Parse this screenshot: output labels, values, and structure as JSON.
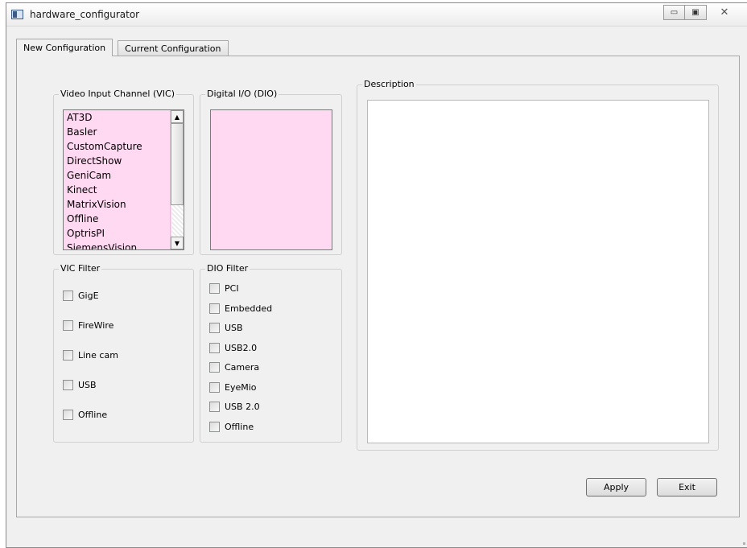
{
  "window": {
    "title": "hardware_configurator",
    "minimize": "▭",
    "maximize": "▣",
    "close": "✕"
  },
  "tabs": [
    {
      "label": "New Configuration",
      "active": true
    },
    {
      "label": "Current Configuration",
      "active": false
    }
  ],
  "vic": {
    "title": "Video Input Channel (VIC)",
    "items": [
      "AT3D",
      "Basler",
      "CustomCapture",
      "DirectShow",
      "GeniCam",
      "Kinect",
      "MatrixVision",
      "Offline",
      "OptrisPI",
      "SiemensVision"
    ],
    "list_color": "#ffd9f2"
  },
  "dio": {
    "title": "Digital I/O (DIO)",
    "items": []
  },
  "vic_filter": {
    "title": "VIC Filter",
    "options": [
      {
        "label": "GigE",
        "checked": false
      },
      {
        "label": "FireWire",
        "checked": false
      },
      {
        "label": "Line cam",
        "checked": false
      },
      {
        "label": "USB",
        "checked": false
      },
      {
        "label": "Offline",
        "checked": false
      }
    ]
  },
  "dio_filter": {
    "title": "DIO Filter",
    "options": [
      {
        "label": "PCI",
        "checked": false
      },
      {
        "label": "Embedded",
        "checked": false
      },
      {
        "label": "USB",
        "checked": false
      },
      {
        "label": "USB2.0",
        "checked": false
      },
      {
        "label": "Camera",
        "checked": false
      },
      {
        "label": "EyeMio",
        "checked": false
      },
      {
        "label": "USB 2.0",
        "checked": false
      },
      {
        "label": "Offline",
        "checked": false
      }
    ]
  },
  "description": {
    "title": "Description",
    "value": ""
  },
  "buttons": {
    "apply": "Apply",
    "exit": "Exit"
  },
  "scrollbar": {
    "up": "▲",
    "down": "▼"
  }
}
